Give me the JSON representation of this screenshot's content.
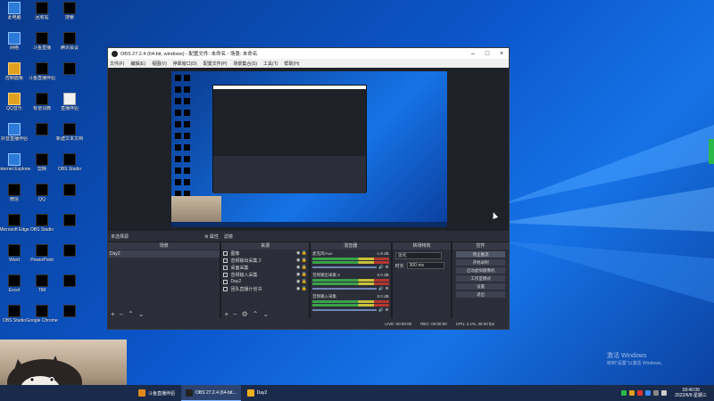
{
  "desktop": {
    "icons": [
      {
        "label": "此电脑"
      },
      {
        "label": "回收站"
      },
      {
        "label": "搜索"
      },
      {
        "label": "网络"
      },
      {
        "label": "斗鱼直播"
      },
      {
        "label": "腾讯会议"
      },
      {
        "label": "控制面板"
      },
      {
        "label": "斗鱼直播伴侣"
      },
      {
        "label": ""
      },
      {
        "label": "QQ音乐"
      },
      {
        "label": "有道词典"
      },
      {
        "label": "直播伴侣"
      },
      {
        "label": "抖音直播伴侣"
      },
      {
        "label": ""
      },
      {
        "label": "新建文本文档"
      },
      {
        "label": "Internet Explorer"
      },
      {
        "label": "剪映"
      },
      {
        "label": "OBS Studio"
      },
      {
        "label": "微信"
      },
      {
        "label": "QQ"
      },
      {
        "label": ""
      },
      {
        "label": "Microsoft Edge"
      },
      {
        "label": "OBS Studio"
      },
      {
        "label": ""
      },
      {
        "label": "Word"
      },
      {
        "label": "PowerPoint"
      },
      {
        "label": ""
      },
      {
        "label": "Excel"
      },
      {
        "label": "TIM"
      },
      {
        "label": ""
      },
      {
        "label": "OBS Studio"
      },
      {
        "label": "Google Chrome"
      },
      {
        "label": ""
      }
    ]
  },
  "obs": {
    "title": "OBS 27.2.4 (64-bit, windows) - 配置文件: 未命名 - 场景: 未命名",
    "menu": [
      "文件(F)",
      "编辑(E)",
      "视图(V)",
      "停靠窗口(D)",
      "配置文件(P)",
      "场景集合(S)",
      "工具(T)",
      "帮助(H)"
    ],
    "scene_bar": {
      "label": "未选择源",
      "props": "⚙ 属性",
      "filters": "滤镜"
    },
    "docks": {
      "scenes": {
        "header": "场景",
        "items": [
          "Day2"
        ]
      },
      "sources": {
        "header": "来源",
        "items": [
          {
            "name": "图像",
            "icon": "image-icon"
          },
          {
            "name": "音频输出采集 2",
            "icon": "speaker-icon"
          },
          {
            "name": "桌面采集",
            "icon": "monitor-icon"
          },
          {
            "name": "音频输入采集",
            "icon": "mic-icon"
          },
          {
            "name": "Day2",
            "icon": "scene-icon"
          },
          {
            "name": "团队直播计划书",
            "icon": "text-icon"
          }
        ]
      },
      "mixer": {
        "header": "混音器",
        "channels": [
          {
            "name": "麦克风/Aux",
            "db": "-1.9 dB"
          },
          {
            "name": "音频输出采集 2",
            "db": "0.0 dB"
          },
          {
            "name": "音频输入采集",
            "db": "0.0 dB"
          }
        ]
      },
      "transitions": {
        "header": "转场特效",
        "selected": "淡化",
        "duration_label": "时长",
        "duration": "300 ms"
      },
      "controls": {
        "header": "控件",
        "buttons": [
          "停止推流",
          "开始录制",
          "启动虚拟摄像机",
          "工作室模式",
          "设置",
          "退出"
        ]
      }
    },
    "status": {
      "live": "LIVE: 00:00:00",
      "rec": "REC: 00:00:00",
      "cpu": "CPU: 2.1%, 30.00 fps"
    }
  },
  "taskbar": {
    "apps": [
      {
        "label": "斗鱼直播伴侣",
        "color": "#e08a1e"
      },
      {
        "label": "OBS 27.2.4 (64-bit...",
        "color": "#222222"
      },
      {
        "label": "Day2",
        "color": "#f0b020"
      }
    ],
    "time": "18:40:09",
    "date": "2022/6/8 星期三"
  },
  "watermark": {
    "line1": "激活 Windows",
    "line2": "转到\"设置\"以激活 Windows。"
  },
  "colors": {
    "accent": "#0b55c9",
    "obs_bg": "#272a33"
  }
}
